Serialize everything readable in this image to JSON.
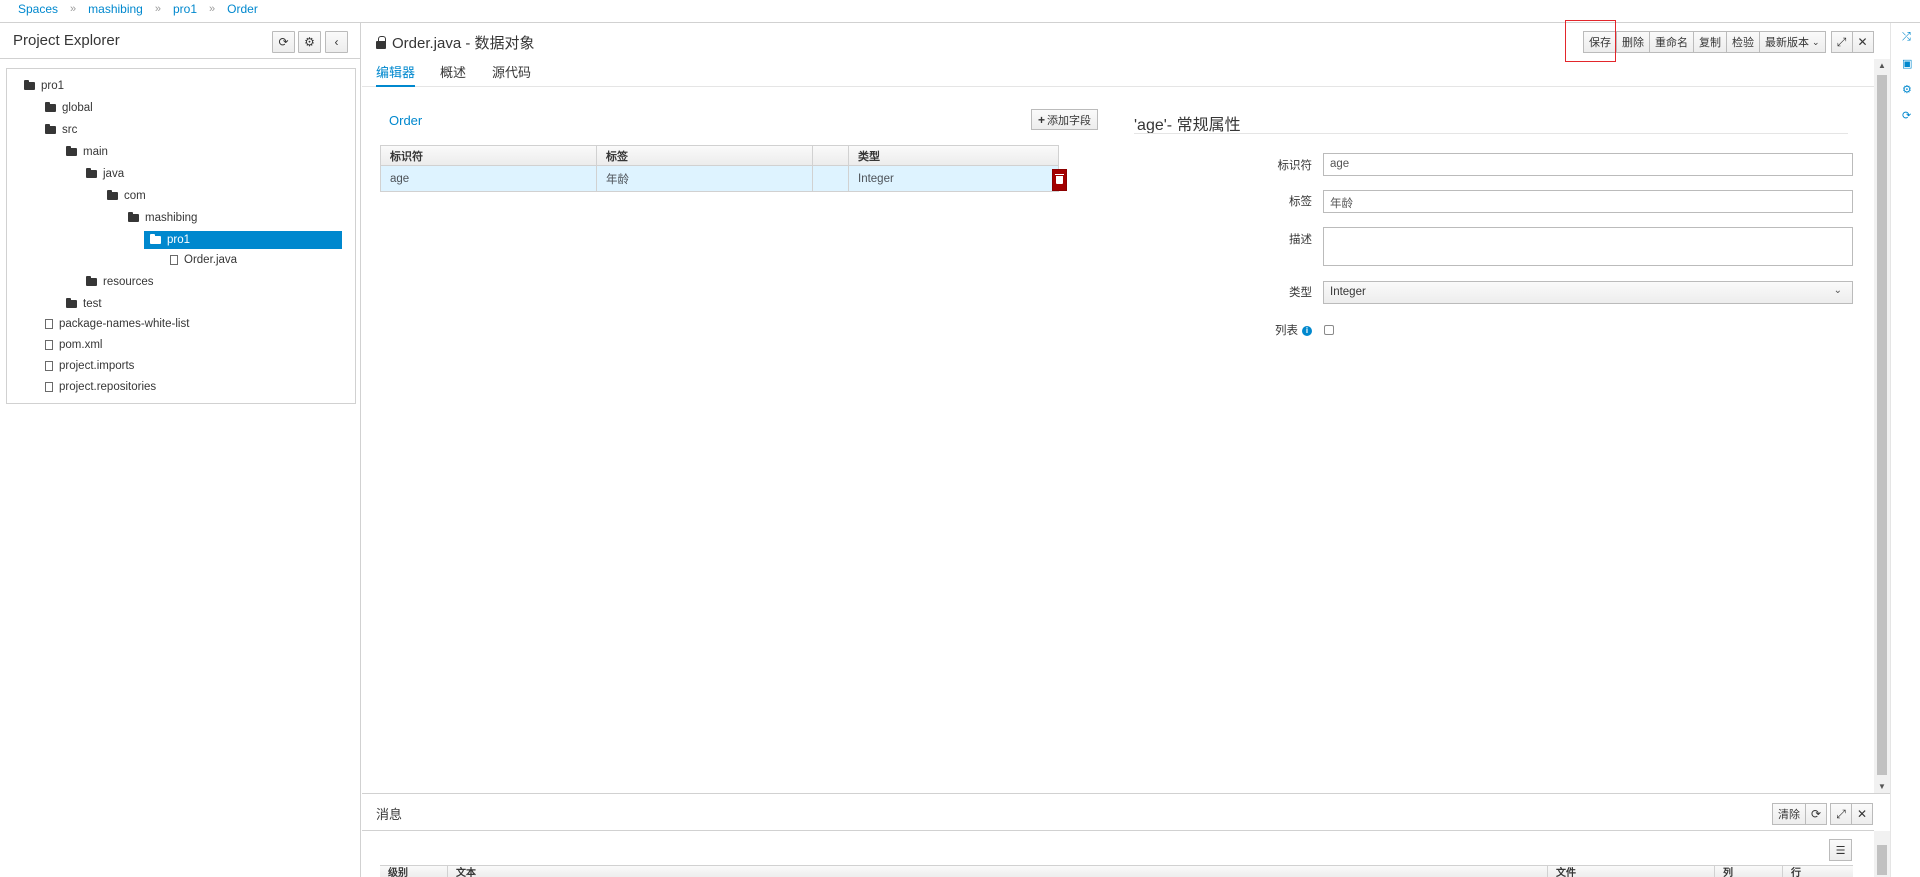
{
  "breadcrumb": [
    "Spaces",
    "mashibing",
    "pro1",
    "Order"
  ],
  "explorer": {
    "title": "Project Explorer",
    "tree": [
      {
        "label": "pro1",
        "type": "folder"
      },
      {
        "label": "global",
        "type": "folder"
      },
      {
        "label": "src",
        "type": "folder"
      },
      {
        "label": "main",
        "type": "folder"
      },
      {
        "label": "java",
        "type": "folder"
      },
      {
        "label": "com",
        "type": "folder"
      },
      {
        "label": "mashibing",
        "type": "folder"
      },
      {
        "label": "pro1",
        "type": "folder",
        "selected": true
      },
      {
        "label": "Order.java",
        "type": "file"
      },
      {
        "label": "resources",
        "type": "folder"
      },
      {
        "label": "test",
        "type": "folder"
      },
      {
        "label": "package-names-white-list",
        "type": "file"
      },
      {
        "label": "pom.xml",
        "type": "file"
      },
      {
        "label": "project.imports",
        "type": "file"
      },
      {
        "label": "project.repositories",
        "type": "file"
      }
    ]
  },
  "editor": {
    "title": "Order.java - 数据对象",
    "toolbar": {
      "save": "保存",
      "delete": "删除",
      "rename": "重命名",
      "copy": "复制",
      "validate": "检验",
      "latest_version": "最新版本"
    },
    "tabs": [
      "编辑器",
      "概述",
      "源代码"
    ],
    "object_name": "Order",
    "add_field": "添加字段",
    "grid": {
      "columns": [
        "标识符",
        "标签",
        "",
        "类型"
      ],
      "rows": [
        {
          "identifier": "age",
          "label": "年龄",
          "type": "Integer"
        }
      ]
    },
    "properties": {
      "title": "'age'- 常规属性",
      "identifier_label": "标识符",
      "identifier_value": "age",
      "label_label": "标签",
      "label_value": "年龄",
      "description_label": "描述",
      "description_value": "",
      "type_label": "类型",
      "type_value": "Integer",
      "list_label": "列表",
      "list_checked": false
    }
  },
  "messages": {
    "title": "消息",
    "clear": "清除",
    "columns": [
      "级别",
      "文本",
      "文件",
      "列",
      "行"
    ]
  },
  "colors": {
    "accent": "#0088ce",
    "selected_row": "#def3ff",
    "danger": "#a30000",
    "highlight": "#e3262b"
  }
}
